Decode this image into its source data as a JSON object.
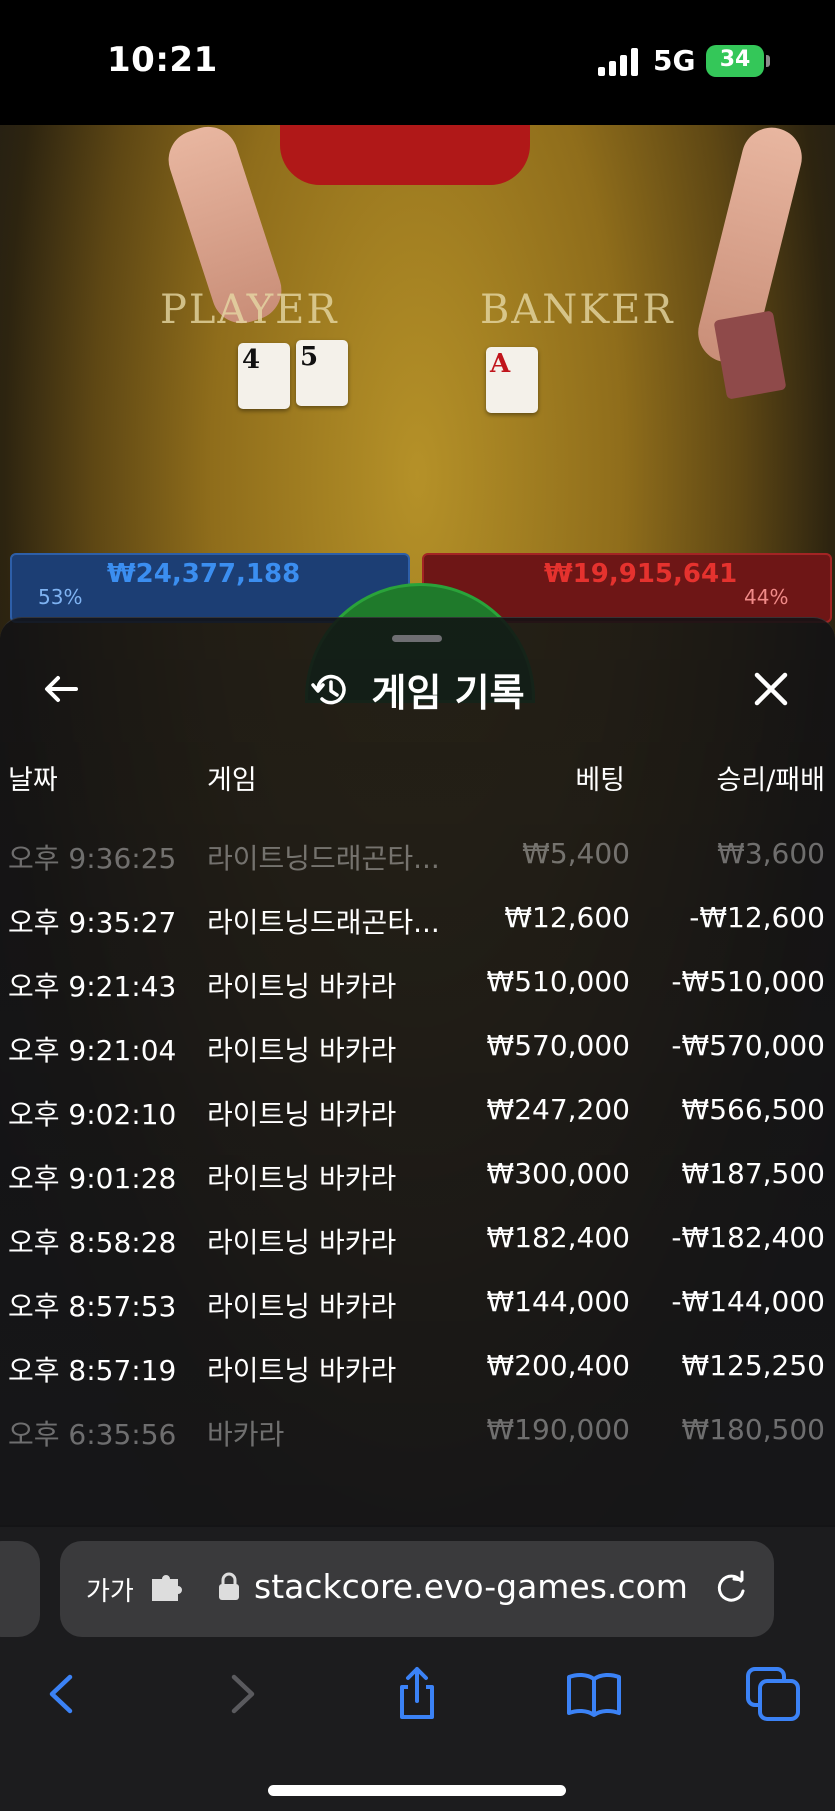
{
  "status_bar": {
    "time": "10:21",
    "network": "5G",
    "battery": "34"
  },
  "game_video": {
    "player_label": "PLAYER",
    "banker_label": "BANKER",
    "player_cards": [
      "4",
      "5"
    ],
    "banker_cards": [
      "A"
    ],
    "player_bet": "₩24,377,188",
    "player_pct": "53%",
    "banker_bet": "₩19,915,641",
    "banker_pct": "44%"
  },
  "history": {
    "title": "게임 기록",
    "columns": {
      "date": "날짜",
      "game": "게임",
      "bet": "베팅",
      "result": "승리/패배"
    },
    "rows": [
      {
        "time": "오후 9:36:25",
        "game": "라이트닝드래곤타...",
        "bet": "₩5,400",
        "result": "₩3,600"
      },
      {
        "time": "오후 9:35:27",
        "game": "라이트닝드래곤타...",
        "bet": "₩12,600",
        "result": "-₩12,600"
      },
      {
        "time": "오후 9:21:43",
        "game": "라이트닝 바카라",
        "bet": "₩510,000",
        "result": "-₩510,000"
      },
      {
        "time": "오후 9:21:04",
        "game": "라이트닝 바카라",
        "bet": "₩570,000",
        "result": "-₩570,000"
      },
      {
        "time": "오후 9:02:10",
        "game": "라이트닝 바카라",
        "bet": "₩247,200",
        "result": "₩566,500"
      },
      {
        "time": "오후 9:01:28",
        "game": "라이트닝 바카라",
        "bet": "₩300,000",
        "result": "₩187,500"
      },
      {
        "time": "오후 8:58:28",
        "game": "라이트닝 바카라",
        "bet": "₩182,400",
        "result": "-₩182,400"
      },
      {
        "time": "오후 8:57:53",
        "game": "라이트닝 바카라",
        "bet": "₩144,000",
        "result": "-₩144,000"
      },
      {
        "time": "오후 8:57:19",
        "game": "라이트닝 바카라",
        "bet": "₩200,400",
        "result": "₩125,250"
      },
      {
        "time": "오후 6:35:56",
        "game": "바카라",
        "bet": "₩190,000",
        "result": "₩180,500"
      }
    ]
  },
  "browser": {
    "aa_label": "가가",
    "url": "stackcore.evo-games.com"
  },
  "colors": {
    "player_blue": "#3b8ef0",
    "banker_red": "#e5322e",
    "safari_blue": "#3b82f6"
  }
}
